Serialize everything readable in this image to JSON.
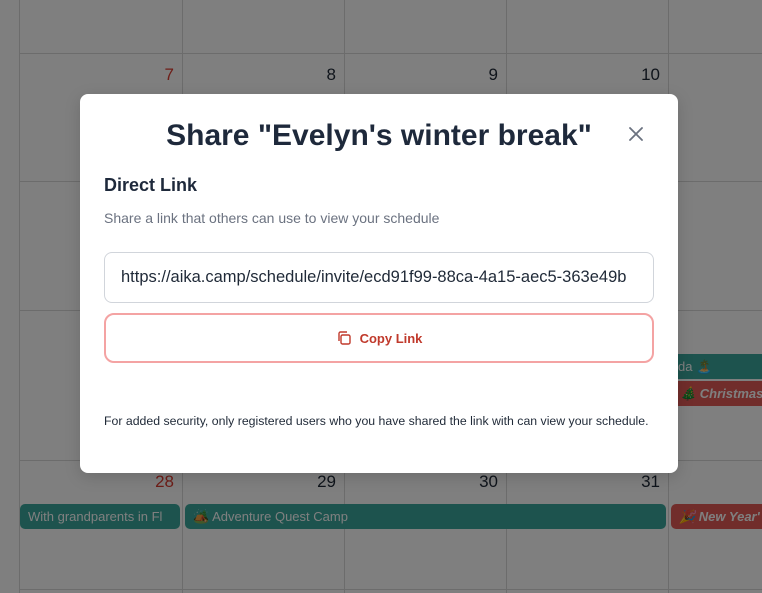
{
  "calendar": {
    "days": [
      {
        "label": "7",
        "weekend": true
      },
      {
        "label": "8",
        "weekend": false
      },
      {
        "label": "9",
        "weekend": false
      },
      {
        "label": "10",
        "weekend": false
      },
      {
        "label": "28",
        "weekend": true
      },
      {
        "label": "29",
        "weekend": false
      },
      {
        "label": "30",
        "weekend": false
      },
      {
        "label": "31",
        "weekend": false
      }
    ],
    "events": [
      {
        "label": "da 🏝️",
        "color": "#3aa79d"
      },
      {
        "label": "🎄 Christmas",
        "color": "#e25b56"
      },
      {
        "label": "With grandparents in Fl",
        "color": "#3aa79d"
      },
      {
        "label": "🏕️ Adventure Quest Camp",
        "color": "#3aa79d"
      },
      {
        "label": "🎉 New Year'",
        "color": "#e25b56"
      }
    ]
  },
  "modal": {
    "title": "Share \"Evelyn's winter break\"",
    "section_title": "Direct Link",
    "description": "Share a link that others can use to view your schedule",
    "link_value": "https://aika.camp/schedule/invite/ecd91f99-88ca-4a15-aec5-363e49b",
    "copy_label": "Copy Link",
    "note": "For added security, only registered users who you have shared the link with can view your schedule.",
    "accent_color": "#c0392b"
  }
}
